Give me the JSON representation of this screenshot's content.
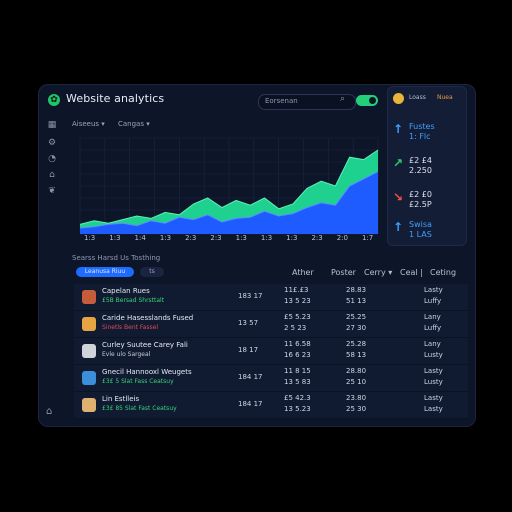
{
  "app": {
    "title": "Website analytics",
    "search_placeholder": "Eorsenan",
    "brand_icon": "leaf-icon"
  },
  "filters": [
    "Aiseeus",
    "Cangas"
  ],
  "sidebar_icons": [
    "grid-icon",
    "gear-icon",
    "chart-icon",
    "tag-icon",
    "leaf-icon",
    "home-icon"
  ],
  "chart_data": {
    "type": "area",
    "x": [
      "1:3",
      "1:3",
      "1:2",
      "1:3",
      "2:3",
      "1:3",
      "2:3",
      "2:0",
      "1:3",
      "1:4",
      "1:3",
      "1:3",
      "2:3",
      "1:3"
    ],
    "x_tick_labels": [
      "1:3",
      "1:3",
      "1:4",
      "1:3",
      "2:3",
      "2:3",
      "1:3",
      "1:3",
      "1:3",
      "2:3",
      "2:0",
      "1:7"
    ],
    "series": [
      {
        "name": "",
        "color": "#1fd18f",
        "values": [
          8,
          11,
          9,
          12,
          15,
          13,
          18,
          16,
          25,
          30,
          22,
          28,
          24,
          30,
          21,
          25,
          38,
          44,
          40,
          64,
          62,
          70
        ]
      },
      {
        "name": "",
        "color": "#1f5cff",
        "values": [
          5,
          6,
          8,
          9,
          7,
          11,
          9,
          14,
          12,
          16,
          10,
          13,
          14,
          19,
          15,
          17,
          22,
          26,
          24,
          40,
          46,
          52
        ]
      }
    ],
    "ylim": [
      0,
      80
    ],
    "grid": true
  },
  "stats_panel": {
    "header_left": "Loass",
    "header_right": "Nuea",
    "items": [
      {
        "icon": "arrow-up-icon",
        "value": "Fustes",
        "sub": "1: Flc",
        "color": "#3ea0ff"
      },
      {
        "icon": "trend-up-icon",
        "value": "£2 £4",
        "sub": "2.250",
        "color": "#2bd06b"
      },
      {
        "icon": "trend-down-icon",
        "value": "£2 £0",
        "sub": "£2.5P",
        "color": "#ff4d4d"
      },
      {
        "icon": "arrow-up-icon",
        "value": "Swisa",
        "sub": "1 LAS",
        "color": "#3ea0ff"
      }
    ]
  },
  "table_section": {
    "caption": "Searss Harsd Us Tosthing",
    "tab_active": "Leanusa Riuu",
    "tab_other": "ts",
    "columns": [
      "Ather",
      "Poster",
      "Cerry",
      "Ceal",
      "Ceting"
    ],
    "rows": [
      {
        "title": "Capelan Rues",
        "sub": "£5B  Bersad Shrsttalt",
        "sub_color": "#39d47a",
        "c1": "183 17",
        "c2": "11£.£3",
        "c2b": "13 5 23",
        "c3": "28.83",
        "c3b": "51 13",
        "c4": "Lasty",
        "c4b": "Luffy",
        "avatar": "#c65d3a"
      },
      {
        "title": "Caride Hasesslands Fused",
        "sub": "Sinetls Bent Fassel",
        "sub_color": "#e14b5a",
        "c1": "13 57",
        "c2": "£5 5.23",
        "c2b": "2 5 23",
        "c3": "25.25",
        "c3b": "27 30",
        "c4": "Lany",
        "c4b": "Luffy",
        "avatar": "#e6a442"
      },
      {
        "title": "Curley Suutee Carey Fali",
        "sub": "Evle ulo Sargeal",
        "sub_color": "#c7ccd9",
        "c1": "18 17",
        "c2": "11 6.58",
        "c2b": "16 6 23",
        "c3": "25.28",
        "c3b": "58 13",
        "c4": "Lany",
        "c4b": "Lusty",
        "avatar": "#d0d3da"
      },
      {
        "title": "Gnecil Hannooxl Weugets",
        "sub": "£3£ 5  Slat Fass Ceatsuy",
        "sub_color": "#39d47a",
        "c1": "184 17",
        "c2": "11 8 15",
        "c2b": "13 5 83",
        "c3": "28.80",
        "c3b": "25 10",
        "c4": "Lasty",
        "c4b": "Lusty",
        "avatar": "#3a8fd8"
      },
      {
        "title": "Lin Estlleis",
        "sub": "£3£ 85  Slat Fast Ceatsuy",
        "sub_color": "#39d47a",
        "c1": "184 17",
        "c2": "£5 42.3",
        "c2b": "13 5.23",
        "c3": "23.80",
        "c3b": "25 30",
        "c4": "Lasty",
        "c4b": "Lasty",
        "avatar": "#e0b070"
      }
    ]
  }
}
